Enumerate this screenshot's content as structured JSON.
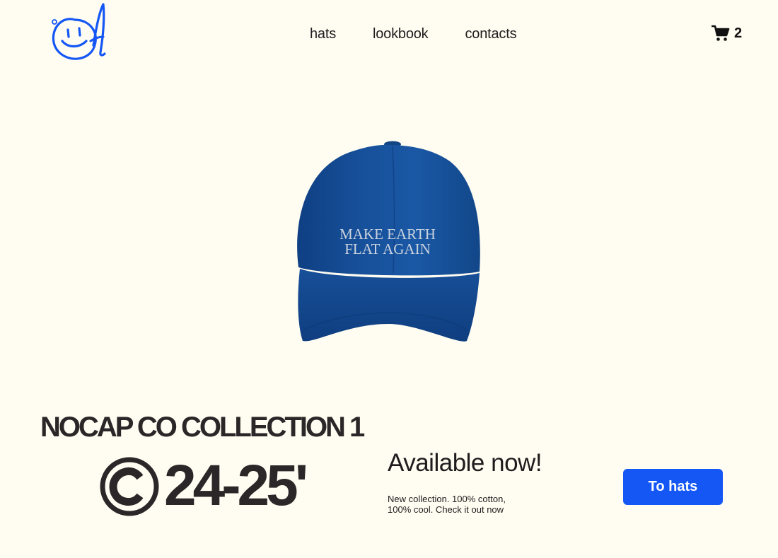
{
  "header": {
    "logo": "smiley-signature-logo",
    "nav": [
      {
        "label": "hats"
      },
      {
        "label": "lookbook"
      },
      {
        "label": "contacts"
      }
    ],
    "cart": {
      "icon": "shopping-cart-icon",
      "count": "2"
    }
  },
  "hero": {
    "product_image": "blue-cap",
    "cap_text_line1": "MAKE EARTH",
    "cap_text_line2": "FLAT AGAIN",
    "cap_color": "#17509a"
  },
  "collection": {
    "title": "NOCAP CO COLLECTION 1",
    "copyright_icon": "copyright-icon",
    "season": "24-25'"
  },
  "cta": {
    "heading": "Available now!",
    "description": "New collection. 100% cotton, 100% cool. Check it out now",
    "button_label": "To hats",
    "button_color": "#1457f5"
  },
  "colors": {
    "background": "#fffcf1",
    "text": "#2b2729",
    "accent": "#1457f5"
  }
}
